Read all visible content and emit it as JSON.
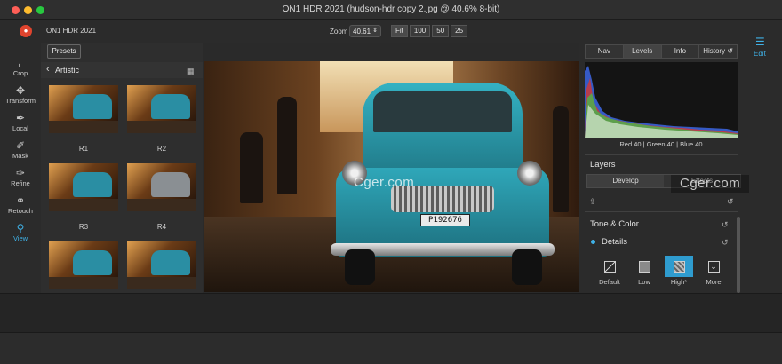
{
  "window": {
    "title": "ON1 HDR 2021 (hudson-hdr copy 2.jpg @ 40.6% 8-bit)"
  },
  "app": {
    "name": "ON1 HDR 2021",
    "logo_icon": "on1-logo-icon"
  },
  "zoom": {
    "label": "Zoom",
    "value": "40.61",
    "buttons": [
      "Fit",
      "100",
      "50",
      "25"
    ],
    "selected": "Fit"
  },
  "tools": [
    {
      "label": "Crop",
      "icon": "crop-icon"
    },
    {
      "label": "Transform",
      "icon": "move-icon"
    },
    {
      "label": "Local",
      "icon": "brush-icon"
    },
    {
      "label": "Mask",
      "icon": "mask-brush-icon"
    },
    {
      "label": "Refine",
      "icon": "refine-brush-icon"
    },
    {
      "label": "Retouch",
      "icon": "retouch-icon"
    },
    {
      "label": "View",
      "icon": "view-zoom-icon",
      "active": true
    }
  ],
  "browser": {
    "presets_button": "Presets",
    "category": "Artistic",
    "thumbs": [
      {
        "label": "R1"
      },
      {
        "label": "R2"
      },
      {
        "label": "R3"
      },
      {
        "label": "R4"
      },
      {
        "label": ""
      },
      {
        "label": ""
      }
    ]
  },
  "image": {
    "plate_text": "P192676"
  },
  "panel": {
    "tabs": [
      "Nav",
      "Levels",
      "Info",
      "History"
    ],
    "selected_tab": "Levels",
    "rgb": {
      "red_label": "Red",
      "red": "40",
      "green_label": "Green",
      "green": "40",
      "blue_label": "Blue",
      "blue": "40"
    },
    "layers_title": "Layers",
    "segments": [
      "Develop",
      "Effects"
    ],
    "selected_segment": "Develop",
    "tone_color": "Tone & Color",
    "details": "Details",
    "detail_presets": [
      {
        "label": "Default",
        "icon": "default-slash-icon"
      },
      {
        "label": "Low",
        "icon": "low-detail-icon"
      },
      {
        "label": "High*",
        "icon": "high-detail-icon",
        "selected": true
      },
      {
        "label": "More",
        "icon": "more-chevron-icon"
      }
    ]
  },
  "edit_module": {
    "label": "Edit",
    "icon": "sliders-icon"
  },
  "watermark": {
    "text1": "Cger.com",
    "text2": "Cger.com"
  },
  "colors": {
    "accent": "#3fb1e6",
    "logo": "#e0442e",
    "background": "#2a2a2a"
  }
}
